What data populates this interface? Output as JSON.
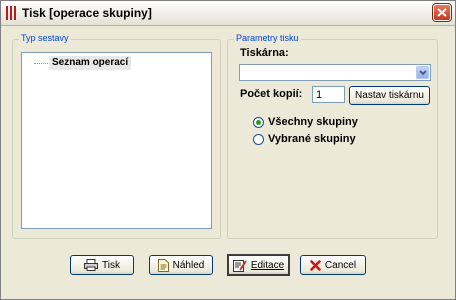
{
  "window": {
    "title": "Tisk [operace skupiny]"
  },
  "report_type": {
    "legend": "Typ sestavy",
    "items": [
      {
        "label": "Seznam operací"
      }
    ]
  },
  "print_params": {
    "legend": "Parametry tisku",
    "printer_label": "Tiskárna:",
    "printer_value": "",
    "copies_label": "Počet kopií:",
    "copies_value": "1",
    "printer_setup_button": "Nastav tiskárnu",
    "radio_options": [
      {
        "label": "Všechny skupiny",
        "checked": true
      },
      {
        "label": "Vybrané skupiny",
        "checked": false
      }
    ]
  },
  "buttons": {
    "print": "Tisk",
    "preview": "Náhled",
    "edit": "Editace",
    "cancel": "Cancel"
  },
  "icons": {
    "app": "app-icon",
    "print": "printer-icon",
    "preview": "preview-icon",
    "edit": "edit-icon",
    "cancel": "cancel-icon",
    "close": "close-icon"
  },
  "colors": {
    "window_bg": "#ece9d8",
    "accent_blue": "#0046d5",
    "close_red": "#c2391b",
    "radio_green": "#21a121"
  }
}
